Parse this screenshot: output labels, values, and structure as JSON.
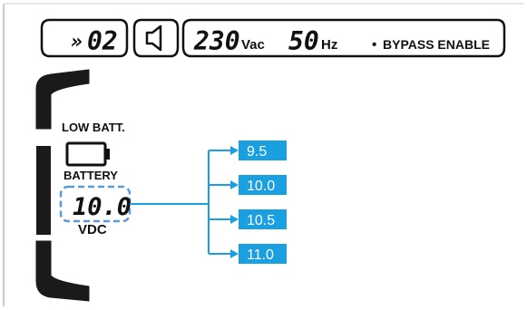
{
  "top_bar": {
    "mode_prefix": "»",
    "mode_number": "02",
    "voltage_value": "230",
    "voltage_unit": "Vac",
    "frequency_value": "50",
    "frequency_unit": "Hz",
    "bypass_bullet": "•",
    "bypass_text": "BYPASS ENABLE"
  },
  "battery_panel": {
    "low_batt_label": "LOW BATT.",
    "battery_label": "BATTERY",
    "value": "10.0",
    "unit": "VDC"
  },
  "options": [
    "9.5",
    "10.0",
    "10.5",
    "11.0"
  ],
  "colors": {
    "accent": "#1aa0e0",
    "dashed": "#5b9bd5",
    "text": "#111111"
  }
}
